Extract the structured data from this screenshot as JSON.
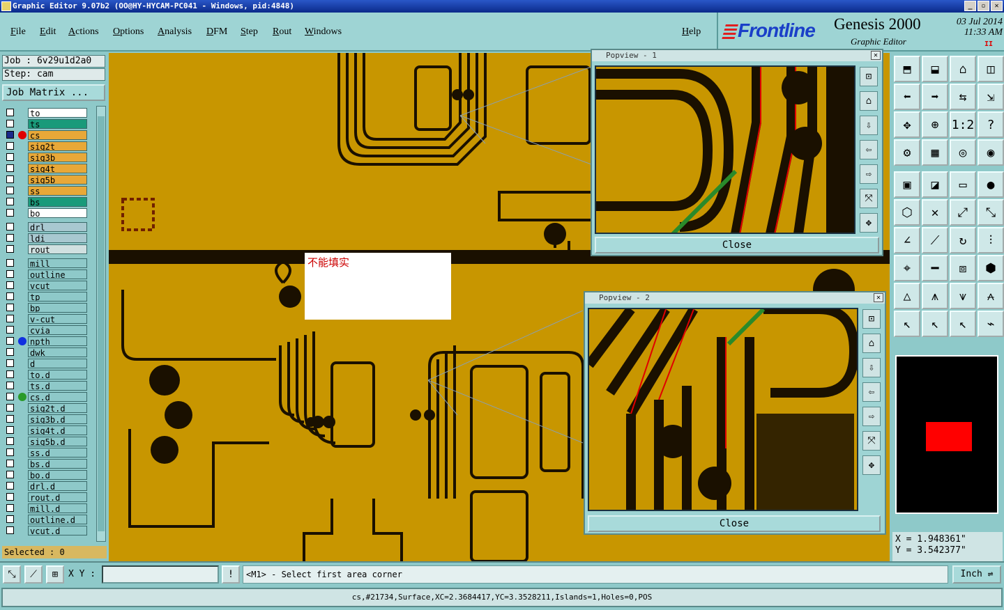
{
  "window": {
    "title": "Graphic Editor 9.07b2 (OO@HY-HYCAM-PC041 - Windows, pid:4848)",
    "buttons": [
      "_",
      "▫",
      "✕"
    ]
  },
  "menu": [
    "File",
    "Edit",
    "Actions",
    "Options",
    "Analysis",
    "DFM",
    "Step",
    "Rout",
    "Windows",
    "Help"
  ],
  "brand": {
    "logo": "Frontline",
    "product": "Genesis 2000",
    "subtitle": "Graphic Editor",
    "date": "03 Jul 2014",
    "time": "11:33 AM",
    "mark": "II"
  },
  "job": {
    "job": "Job : 6v29u1d2a0",
    "step": "Step: cam",
    "matrix_btn": "Job Matrix ..."
  },
  "layers": [
    {
      "name": "to",
      "color": "#ffffff",
      "marker": ""
    },
    {
      "name": "ts",
      "color": "#1a9a7a",
      "marker": ""
    },
    {
      "name": "cs",
      "color": "#e8a838",
      "marker": "#e00000",
      "active": true
    },
    {
      "name": "sig2t",
      "color": "#e8a838",
      "marker": ""
    },
    {
      "name": "sig3b",
      "color": "#e8a838",
      "marker": ""
    },
    {
      "name": "sig4t",
      "color": "#e8a838",
      "marker": ""
    },
    {
      "name": "sig5b",
      "color": "#e8a838",
      "marker": ""
    },
    {
      "name": "ss",
      "color": "#e8a838",
      "marker": ""
    },
    {
      "name": "bs",
      "color": "#1a9a7a",
      "marker": ""
    },
    {
      "name": "bo",
      "color": "#ffffff",
      "marker": ""
    },
    {
      "name": "drl",
      "color": "#a8c8d0",
      "marker": ""
    },
    {
      "name": "ldi",
      "color": "#a8c8d0",
      "marker": ""
    },
    {
      "name": "rout",
      "color": "#d0e0e0",
      "marker": ""
    },
    {
      "name": "mill",
      "color": "#8ec9c9",
      "marker": ""
    },
    {
      "name": "outline",
      "color": "#8ec9c9",
      "marker": ""
    },
    {
      "name": "vcut",
      "color": "#8ec9c9",
      "marker": ""
    },
    {
      "name": "tp",
      "color": "#8ec9c9",
      "marker": ""
    },
    {
      "name": "bp",
      "color": "#8ec9c9",
      "marker": ""
    },
    {
      "name": "v-cut",
      "color": "#8ec9c9",
      "marker": ""
    },
    {
      "name": "cvia",
      "color": "#8ec9c9",
      "marker": ""
    },
    {
      "name": "npth",
      "color": "#8ec9c9",
      "marker": "#1030e0"
    },
    {
      "name": "dwk",
      "color": "#8ec9c9",
      "marker": ""
    },
    {
      "name": "d",
      "color": "#8ec9c9",
      "marker": ""
    },
    {
      "name": "to.d",
      "color": "#8ec9c9",
      "marker": ""
    },
    {
      "name": "ts.d",
      "color": "#8ec9c9",
      "marker": ""
    },
    {
      "name": "cs.d",
      "color": "#8ec9c9",
      "marker": "#2a9a2a"
    },
    {
      "name": "sig2t.d",
      "color": "#8ec9c9",
      "marker": ""
    },
    {
      "name": "sig3b.d",
      "color": "#8ec9c9",
      "marker": ""
    },
    {
      "name": "sig4t.d",
      "color": "#8ec9c9",
      "marker": ""
    },
    {
      "name": "sig5b.d",
      "color": "#8ec9c9",
      "marker": ""
    },
    {
      "name": "ss.d",
      "color": "#8ec9c9",
      "marker": ""
    },
    {
      "name": "bs.d",
      "color": "#8ec9c9",
      "marker": ""
    },
    {
      "name": "bo.d",
      "color": "#8ec9c9",
      "marker": ""
    },
    {
      "name": "drl.d",
      "color": "#8ec9c9",
      "marker": ""
    },
    {
      "name": "rout.d",
      "color": "#8ec9c9",
      "marker": ""
    },
    {
      "name": "mill.d",
      "color": "#8ec9c9",
      "marker": ""
    },
    {
      "name": "outline.d",
      "color": "#8ec9c9",
      "marker": ""
    },
    {
      "name": "vcut.d",
      "color": "#8ec9c9",
      "marker": ""
    }
  ],
  "selected": "Selected : 0",
  "note": "不能填实",
  "popview1": {
    "title": "Popview - 1",
    "close": "Close"
  },
  "popview2": {
    "title": "Popview - 2",
    "close": "Close"
  },
  "coords": {
    "x": "X = 1.948361\"",
    "y": "Y = 3.542377\""
  },
  "cmd": {
    "xy_label": "X Y :",
    "xy_value": "",
    "prompt": "<M1> - Select first area corner",
    "unit": "Inch"
  },
  "status": "cs,#21734,Surface,XC=2.3684417,YC=3.3528211,Islands=1,Holes=0,POS",
  "colors": {
    "copper": "#c89600",
    "ink": "#1a1000",
    "panel": "#8ec9c9",
    "accent_red": "#e00000"
  }
}
